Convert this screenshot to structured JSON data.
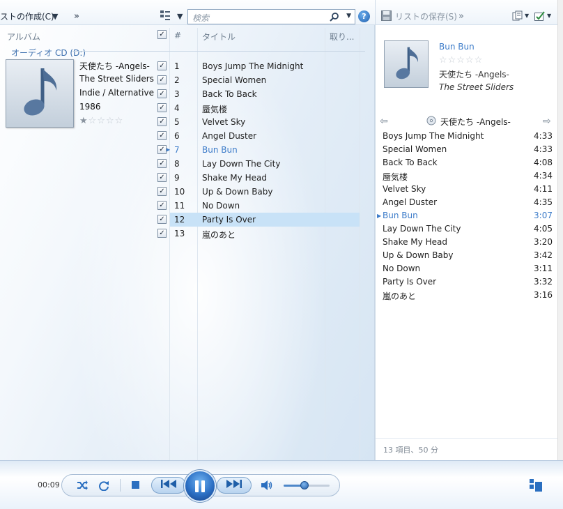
{
  "toolbar": {
    "create_playlist": "ストの作成(C)",
    "search_placeholder": "検索"
  },
  "library": {
    "columns": {
      "album": "アルバム",
      "number": "#",
      "title": "タイトル",
      "rip": "取り..."
    },
    "group_label": "オーディオ CD (D:)",
    "album": {
      "title": "天使たち -Angels-",
      "artist": "The Street Sliders",
      "genre": "Indie / Alternative",
      "year": "1986",
      "rating_stars": 0.5
    },
    "tracks": [
      {
        "num": "1",
        "title": "Boys Jump The Midnight",
        "checked": true
      },
      {
        "num": "2",
        "title": "Special Women",
        "checked": true
      },
      {
        "num": "3",
        "title": "Back To Back",
        "checked": true
      },
      {
        "num": "4",
        "title": "蜃気楼",
        "checked": true
      },
      {
        "num": "5",
        "title": "Velvet Sky",
        "checked": true
      },
      {
        "num": "6",
        "title": "Angel Duster",
        "checked": true
      },
      {
        "num": "7",
        "title": "Bun Bun",
        "checked": true,
        "playing": true
      },
      {
        "num": "8",
        "title": "Lay Down The City",
        "checked": true
      },
      {
        "num": "9",
        "title": "Shake My Head",
        "checked": true
      },
      {
        "num": "10",
        "title": "Up & Down Baby",
        "checked": true
      },
      {
        "num": "11",
        "title": "No Down",
        "checked": true
      },
      {
        "num": "12",
        "title": "Party Is Over",
        "checked": true,
        "selected": true
      },
      {
        "num": "13",
        "title": "嵐のあと",
        "checked": true
      }
    ]
  },
  "list_pane": {
    "save_list": "リストの保存(S)",
    "now_playing": {
      "title": "Bun Bun",
      "album": "天使たち -Angels-",
      "artist": "The Street Sliders"
    },
    "list_title": "天使たち -Angels-",
    "items": [
      {
        "title": "Boys Jump The Midnight",
        "duration": "4:33"
      },
      {
        "title": "Special Women",
        "duration": "4:33"
      },
      {
        "title": "Back To Back",
        "duration": "4:08"
      },
      {
        "title": "蜃気楼",
        "duration": "4:34"
      },
      {
        "title": "Velvet Sky",
        "duration": "4:11"
      },
      {
        "title": "Angel Duster",
        "duration": "4:35"
      },
      {
        "title": "Bun Bun",
        "duration": "3:07",
        "playing": true
      },
      {
        "title": "Lay Down The City",
        "duration": "4:05"
      },
      {
        "title": "Shake My Head",
        "duration": "3:20"
      },
      {
        "title": "Up & Down Baby",
        "duration": "3:42"
      },
      {
        "title": "No Down",
        "duration": "3:11"
      },
      {
        "title": "Party Is Over",
        "duration": "3:32"
      },
      {
        "title": "嵐のあと",
        "duration": "3:16"
      }
    ],
    "footer": "13 項目、50 分"
  },
  "transport": {
    "elapsed": "00:09",
    "volume_fraction": 0.45
  },
  "colors": {
    "accent": "#3d7cc9",
    "selection": "#c8e2f7",
    "play_button": "#2b6fc4"
  },
  "icons": [
    "shuffle-icon",
    "repeat-icon",
    "stop-icon",
    "previous-icon",
    "pause-icon",
    "next-icon",
    "volume-icon",
    "switch-to-now-playing-icon",
    "search-icon",
    "help-icon",
    "music-note-icon",
    "save-icon"
  ]
}
